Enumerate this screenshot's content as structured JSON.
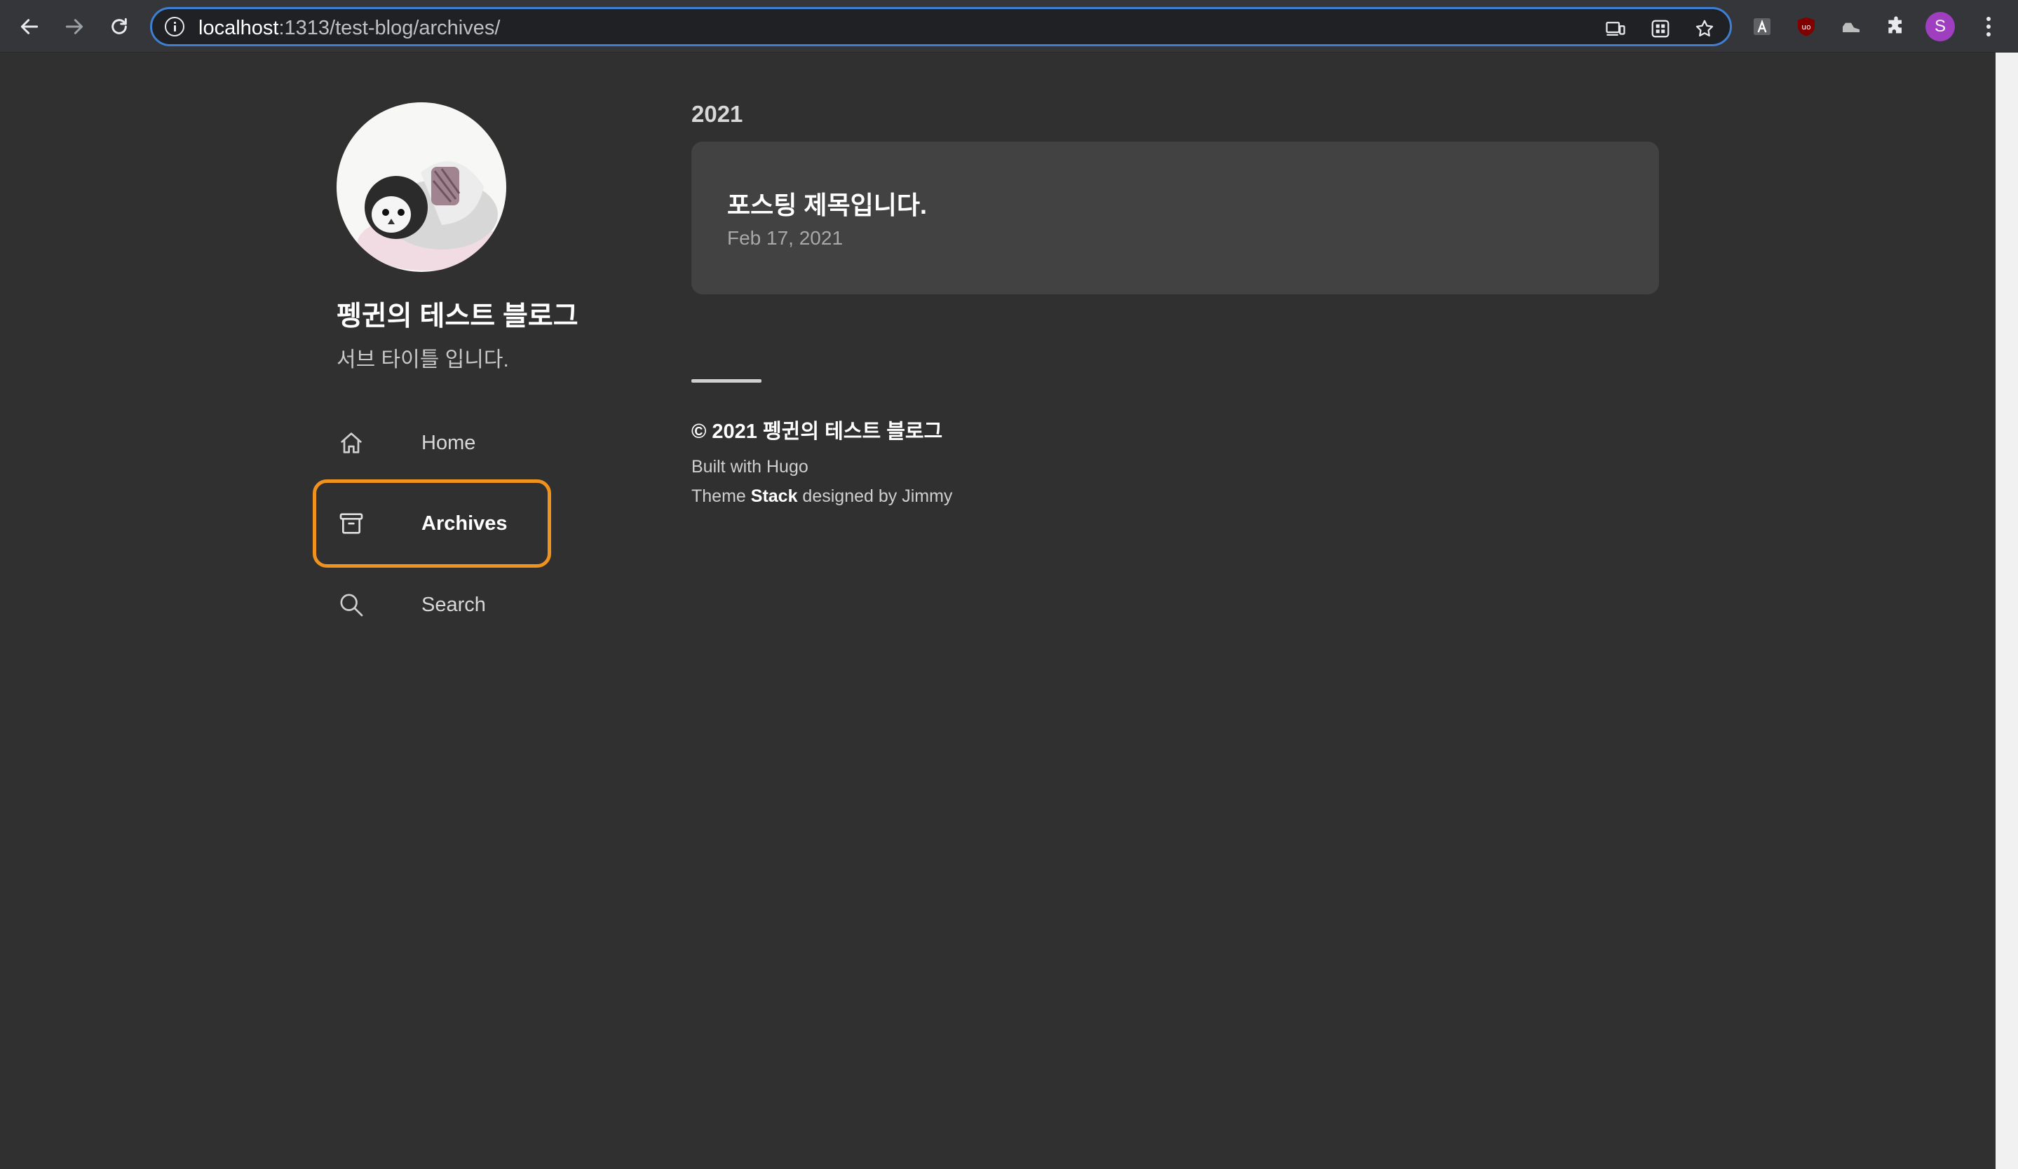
{
  "browser": {
    "url_host": "localhost",
    "url_rest": ":1313/test-blog/archives/",
    "avatar_letter": "S",
    "accent_color": "#3f7fd1"
  },
  "sidebar": {
    "site_title": "펭귄의 테스트 블로그",
    "subtitle": "서브 타이틀 입니다.",
    "menu": [
      {
        "label": "Home",
        "icon": "home-icon"
      },
      {
        "label": "Archives",
        "icon": "archive-icon"
      },
      {
        "label": "Search",
        "icon": "search-icon"
      }
    ],
    "highlight_color": "#f0921e"
  },
  "main": {
    "year": "2021",
    "posts": [
      {
        "title": "포스팅 제목입니다.",
        "date": "Feb 17, 2021"
      }
    ]
  },
  "footer": {
    "copyright": "© 2021 펭귄의 테스트 블로그",
    "built_with": "Built with Hugo",
    "theme_prefix": "Theme ",
    "theme_name": "Stack",
    "theme_suffix": " designed by Jimmy"
  }
}
